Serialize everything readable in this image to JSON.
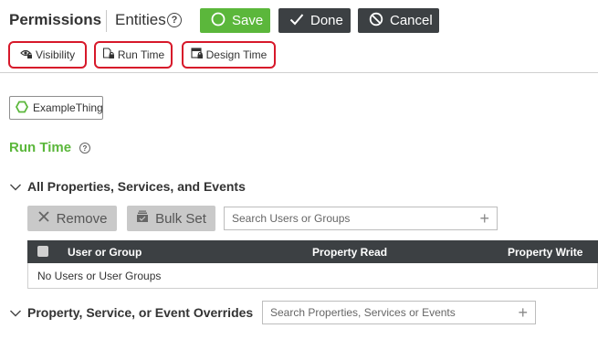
{
  "header": {
    "title": "Permissions",
    "entities_label": "Entities",
    "help_glyph": "?",
    "save_label": "Save",
    "done_label": "Done",
    "cancel_label": "Cancel"
  },
  "tabs": [
    {
      "label": "Visibility",
      "icon": "eye-lock-icon"
    },
    {
      "label": "Run Time",
      "icon": "runtime-lock-icon"
    },
    {
      "label": "Design Time",
      "icon": "designtime-lock-icon"
    }
  ],
  "entity_chip": {
    "label": "ExampleThing",
    "icon": "thing-hexagon-icon"
  },
  "section": {
    "title": "Run Time",
    "help_glyph": "?"
  },
  "all_properties": {
    "title": "All Properties, Services, and Events",
    "remove_label": "Remove",
    "bulk_set_label": "Bulk Set",
    "search_placeholder": "Search Users or Groups",
    "table": {
      "columns": [
        "User or Group",
        "Property Read",
        "Property Write"
      ],
      "empty_text": "No Users or User Groups"
    }
  },
  "overrides": {
    "title": "Property, Service, or Event Overrides",
    "search_placeholder": "Search Properties, Services or Events"
  },
  "colors": {
    "accent_green": "#5bb73b",
    "dark_button": "#3c4043",
    "tab_highlight": "#d7182a",
    "disabled_gray": "#c9c9c9"
  }
}
